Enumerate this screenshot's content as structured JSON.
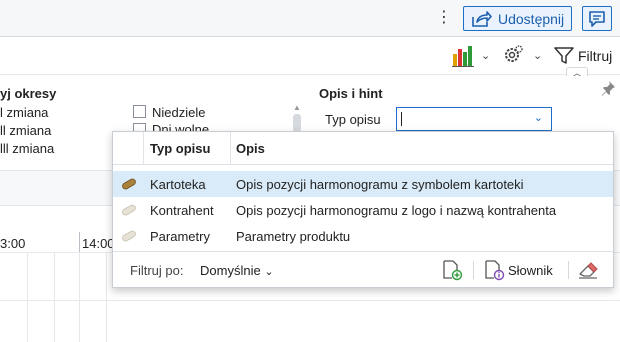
{
  "topbar": {
    "more_icon": "kebab-vertical-icon",
    "share_label": "Udostępnij",
    "share_icon": "share-icon",
    "chat_icon": "chat-icon",
    "accent": "#1b6fc9"
  },
  "toolbar2": {
    "chart_icon": "bar-chart-icon",
    "settings_icon": "gear-icon",
    "filter_label": "Filtruj"
  },
  "panel": {
    "periods_title": "yj okresy",
    "shifts": [
      "l zmiana",
      "ll zmiana",
      "lll zmiana"
    ],
    "days": [
      "Niedziele",
      "Dni wolne"
    ],
    "description_title": "Opis i hint",
    "type_label": "Typ opisu",
    "type_value": ""
  },
  "timeline": {
    "hours": [
      "3:00",
      "14:00"
    ]
  },
  "dropdown": {
    "columns": [
      "Typ opisu",
      "Opis"
    ],
    "rows": [
      {
        "type": "Kartoteka",
        "description": "Opis pozycji harmonogramu z symbolem kartoteki",
        "selected": true
      },
      {
        "type": "Kontrahent",
        "description": "Opis pozycji harmonogramu z logo i nazwą kontrahenta",
        "selected": false
      },
      {
        "type": "Parametry",
        "description": "Parametry produktu",
        "selected": false
      }
    ],
    "footer": {
      "filter_label": "Filtruj po:",
      "filter_value": "Domyślnie",
      "add_icon": "add-document-icon",
      "dictionary_label": "Słownik",
      "clear_icon": "eraser-icon"
    }
  }
}
